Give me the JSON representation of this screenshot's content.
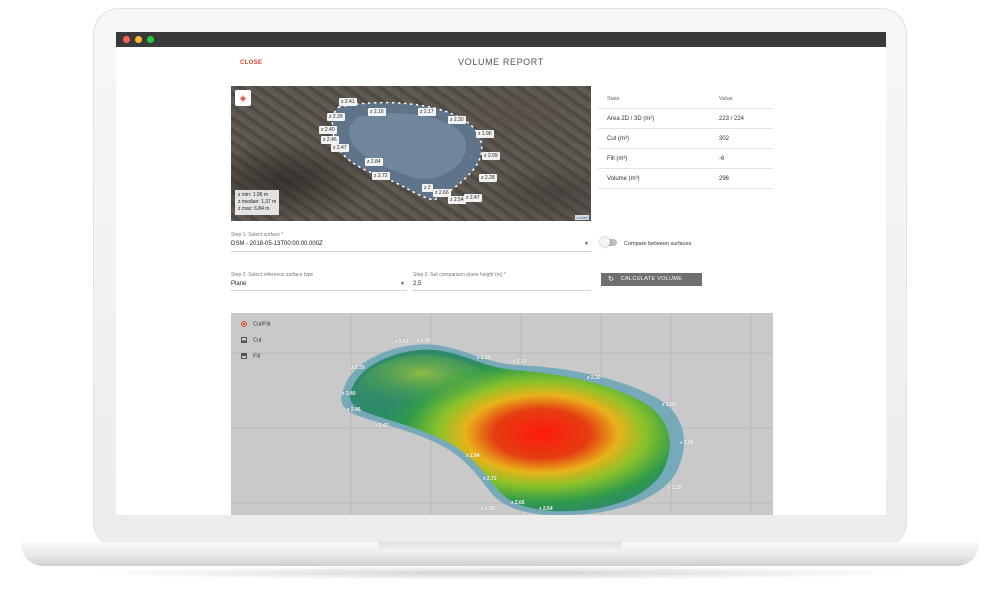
{
  "window": {
    "title": "VOLUME REPORT",
    "close_label": "CLOSE"
  },
  "map": {
    "stats_lines": [
      "z min: 1.96 m",
      "z median: 1.37 m",
      "z max: 6.84 m"
    ],
    "attribution": "Leaflet",
    "layers_icon": "layers-icon",
    "labels": [
      "z 2.41",
      "z 2.39",
      "z 2.16",
      "z 2.17",
      "z 2.30",
      "z 2.40",
      "z 1.96",
      "z 2.46",
      "z 2.47",
      "z 2.09",
      "z 2.84",
      "z 2.72",
      "z 2.28",
      "z 2",
      "z 2.66",
      "z 2.54",
      "z 2.47"
    ]
  },
  "stats": {
    "col_stats": "Stats",
    "col_value": "Value",
    "rows": [
      {
        "label": "Area 2D / 3D (m²)",
        "value": "223 / 224"
      },
      {
        "label": "Cut (m³)",
        "value": "302"
      },
      {
        "label": "Fill (m³)",
        "value": "-6"
      },
      {
        "label": "Volume (m³)",
        "value": "296"
      }
    ]
  },
  "form": {
    "step1_label": "Step 1: Select surface *",
    "step1_value": "DSM - 2018-05-13T00:00:00.000Z",
    "compare_label": "Compare between surfaces",
    "step2_label": "Step 2: Select reference surface type",
    "step2_value": "Plane",
    "step3_label": "Step 3: Set comparison plane height (m) *",
    "step3_value": "2,5",
    "calculate_label": "CALCULATE VOLUME"
  },
  "view3d": {
    "legend": [
      {
        "label": "Cut/Fill",
        "icon": "radio-selected-icon",
        "color": "#e0452a"
      },
      {
        "label": "Cut",
        "icon": "cut-icon",
        "color": "#555555"
      },
      {
        "label": "Fill",
        "icon": "fill-icon",
        "color": "#555555"
      }
    ],
    "labels": [
      "z 2.41",
      "z 2.42",
      "z 2.39",
      "z 2.40",
      "z 2.19",
      "z 2.17",
      "z 2.46",
      "z 2.47",
      "z 2.84",
      "z 2.30",
      "z 1.96",
      "z 2.09",
      "z 2.72",
      "z 2.28",
      "z 2.66",
      "z 2.54",
      "z 2.56"
    ]
  }
}
